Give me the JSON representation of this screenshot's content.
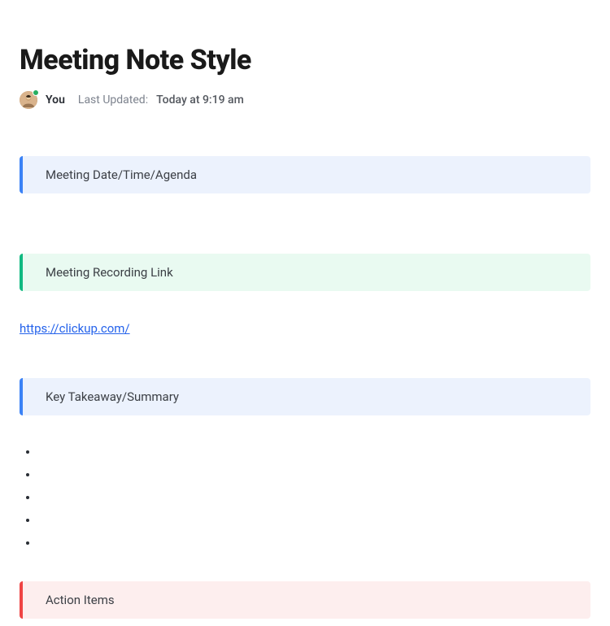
{
  "title": "Meeting Note Style",
  "author": {
    "name": "You",
    "presence": "online"
  },
  "meta": {
    "updated_label": "Last Updated:",
    "updated_value": "Today at 9:19 am"
  },
  "sections": {
    "agenda": {
      "heading": "Meeting Date/Time/Agenda",
      "accent": "blue"
    },
    "recording": {
      "heading": "Meeting Recording Link",
      "accent": "green",
      "link": "https://clickup.com/"
    },
    "takeaway": {
      "heading": "Key Takeaway/Summary",
      "accent": "blue",
      "bullets": [
        "",
        "",
        "",
        "",
        ""
      ]
    },
    "action": {
      "heading": "Action Items",
      "accent": "red"
    }
  }
}
